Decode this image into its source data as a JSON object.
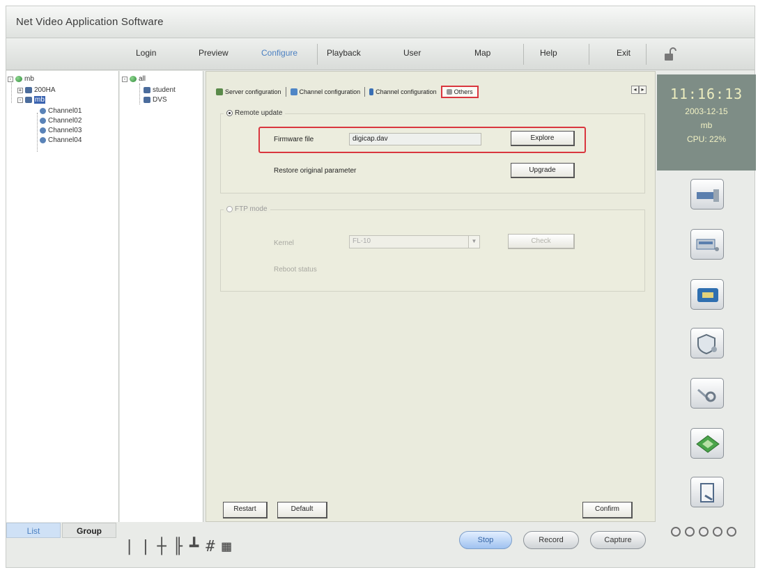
{
  "app": {
    "title": "Net Video Application Software"
  },
  "menu": {
    "items": [
      {
        "label": "Login"
      },
      {
        "label": "Preview"
      },
      {
        "label": "Configure"
      },
      {
        "label": "Playback"
      },
      {
        "label": "User"
      },
      {
        "label": "Map"
      },
      {
        "label": "Help"
      },
      {
        "label": "Exit"
      }
    ],
    "active": "Configure",
    "lock_icon": "unlock-icon"
  },
  "tree_left": {
    "root": "mb",
    "nodes": [
      "200HA",
      "mb"
    ],
    "channels": [
      "Channel01",
      "Channel02",
      "Channel03",
      "Channel04"
    ]
  },
  "tree_right": {
    "root": "all",
    "nodes": [
      "student",
      "DVS"
    ]
  },
  "tabs_bottom": {
    "list": "List",
    "group": "Group"
  },
  "layout_icons": [
    "layout-1-icon",
    "layout-2-icon",
    "layout-4-icon",
    "layout-6-icon",
    "layout-9-icon",
    "layout-16-icon",
    "layout-more-icon"
  ],
  "configure": {
    "subtabs": [
      {
        "label": "Server configuration"
      },
      {
        "label": "Channel configuration"
      },
      {
        "label": "Channel configuration"
      },
      {
        "label": "Others"
      }
    ],
    "group1": {
      "legend": "Remote update",
      "file_label": "Firmware file",
      "file_value": "digicap.dav",
      "explore_label": "Explore",
      "upgrade_label": "Restore original parameter",
      "upgrade_button": "Upgrade"
    },
    "group2": {
      "legend": "FTP mode",
      "label1": "Kernel",
      "select_value": "FL-10",
      "button": "Check",
      "label2": "Reboot status"
    },
    "buttons": {
      "restart": "Restart",
      "default": "Default",
      "confirm": "Confirm"
    }
  },
  "status": {
    "time": "11:16:13",
    "date": "2003-12-15",
    "user": "mb",
    "cpu": "CPU: 22%"
  },
  "right_buttons": [
    "monitor-icon",
    "device-icon",
    "capture-card-icon",
    "shield-icon",
    "search-icon",
    "record-icon",
    "log-icon"
  ],
  "controls": {
    "stop": "Stop",
    "record": "Record",
    "capture": "Capture"
  }
}
